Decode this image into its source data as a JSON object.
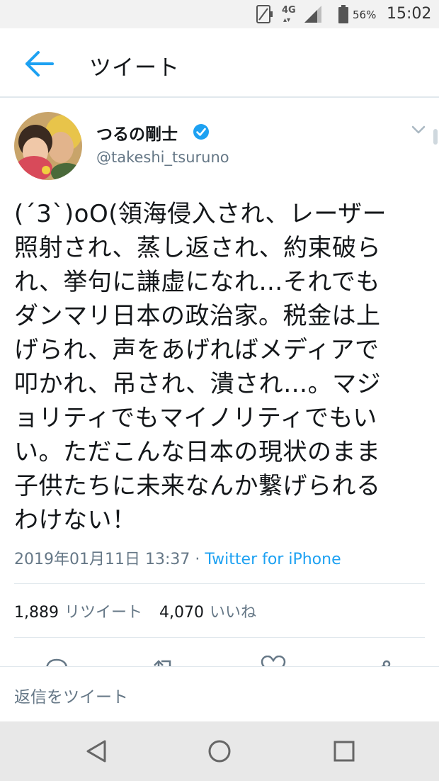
{
  "status_bar": {
    "network": "4G",
    "network_arrows": "▴▾",
    "battery_percent": "56%",
    "time": "15:02"
  },
  "header": {
    "title": "ツイート"
  },
  "tweet": {
    "user_name": "つるの剛士",
    "handle": "@takeshi_tsuruno",
    "text": "(´3`)oO(領海侵入され、レーザー\n照射され、蒸し返され、約束破ら\nれ、挙句に謙虚になれ…それでも\nダンマリ日本の政治家。税金は上\nげられ、声をあげればメディアで\n叩かれ、吊され、潰され…。マジ\nョリティでもマイノリティでもい\nい。ただこんな日本の現状のまま\n子供たちに未来なんか繋げられる\nわけない！",
    "timestamp": "2019年01月11日 13:37",
    "separator": "·",
    "source": "Twitter for iPhone",
    "retweet_count": "1,889",
    "retweet_label": "リツイート",
    "like_count": "4,070",
    "like_label": "いいね"
  },
  "reply": {
    "placeholder": "返信をツイート"
  },
  "colors": {
    "accent": "#1da1f2",
    "secondary_text": "#657786",
    "divider": "#e1e8ed"
  }
}
